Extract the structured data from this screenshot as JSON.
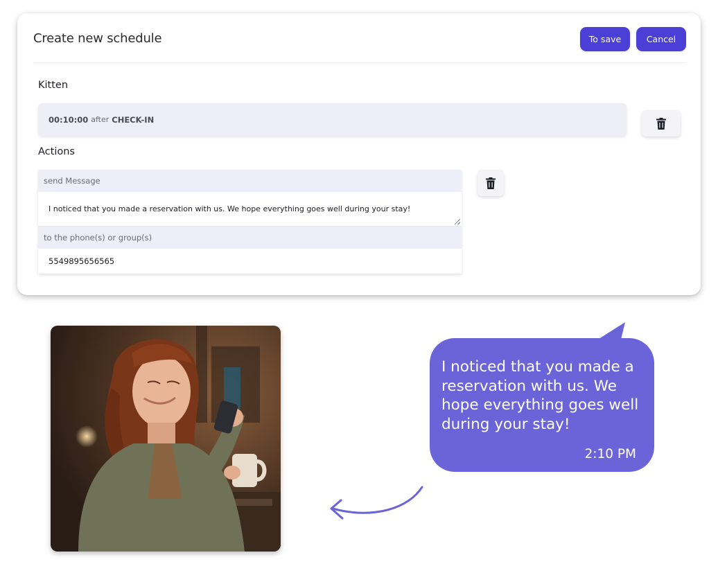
{
  "card": {
    "title": "Create new schedule",
    "save_label": "To save",
    "cancel_label": "Cancel"
  },
  "trigger": {
    "section_label": "Kitten",
    "time": "00:10:00",
    "relation": "after",
    "event": "CHECK-IN"
  },
  "actions": {
    "section_label": "Actions",
    "action_type": "send Message",
    "message": "I noticed that you made a reservation with us. We hope everything goes well during your stay!",
    "recipients_label": "to the phone(s) or group(s)",
    "recipients_value": "5549895656565"
  },
  "chat_bubble": {
    "message": "I noticed that you made a reservation with us. We hope everything goes well during your stay!",
    "time": "2:10 PM"
  },
  "colors": {
    "primary_button": "#4c3fd6",
    "bubble": "#6a64d8",
    "field_background": "#eeeef8"
  },
  "icons": {
    "delete": "trash-icon",
    "arrow": "curved-arrow-icon"
  }
}
